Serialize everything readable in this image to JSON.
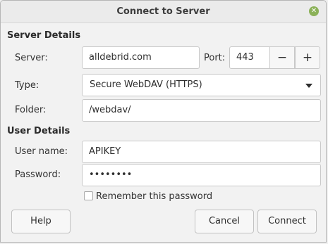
{
  "window": {
    "title": "Connect to Server",
    "close_icon": "close-icon"
  },
  "server_details": {
    "heading": "Server Details",
    "server_label": "Server:",
    "server_value": "alldebrid.com",
    "port_label": "Port:",
    "port_value": "443",
    "port_decrement": "−",
    "port_increment": "+",
    "type_label": "Type:",
    "type_value": "Secure WebDAV (HTTPS)",
    "folder_label": "Folder:",
    "folder_value": "/webdav/"
  },
  "user_details": {
    "heading": "User Details",
    "username_label": "User name:",
    "username_value": "APIKEY",
    "password_label": "Password:",
    "password_value": "••••••••",
    "remember_label": "Remember this password",
    "remember_checked": false
  },
  "buttons": {
    "help": "Help",
    "cancel": "Cancel",
    "connect": "Connect"
  },
  "colors": {
    "close_accent": "#8bb158"
  }
}
